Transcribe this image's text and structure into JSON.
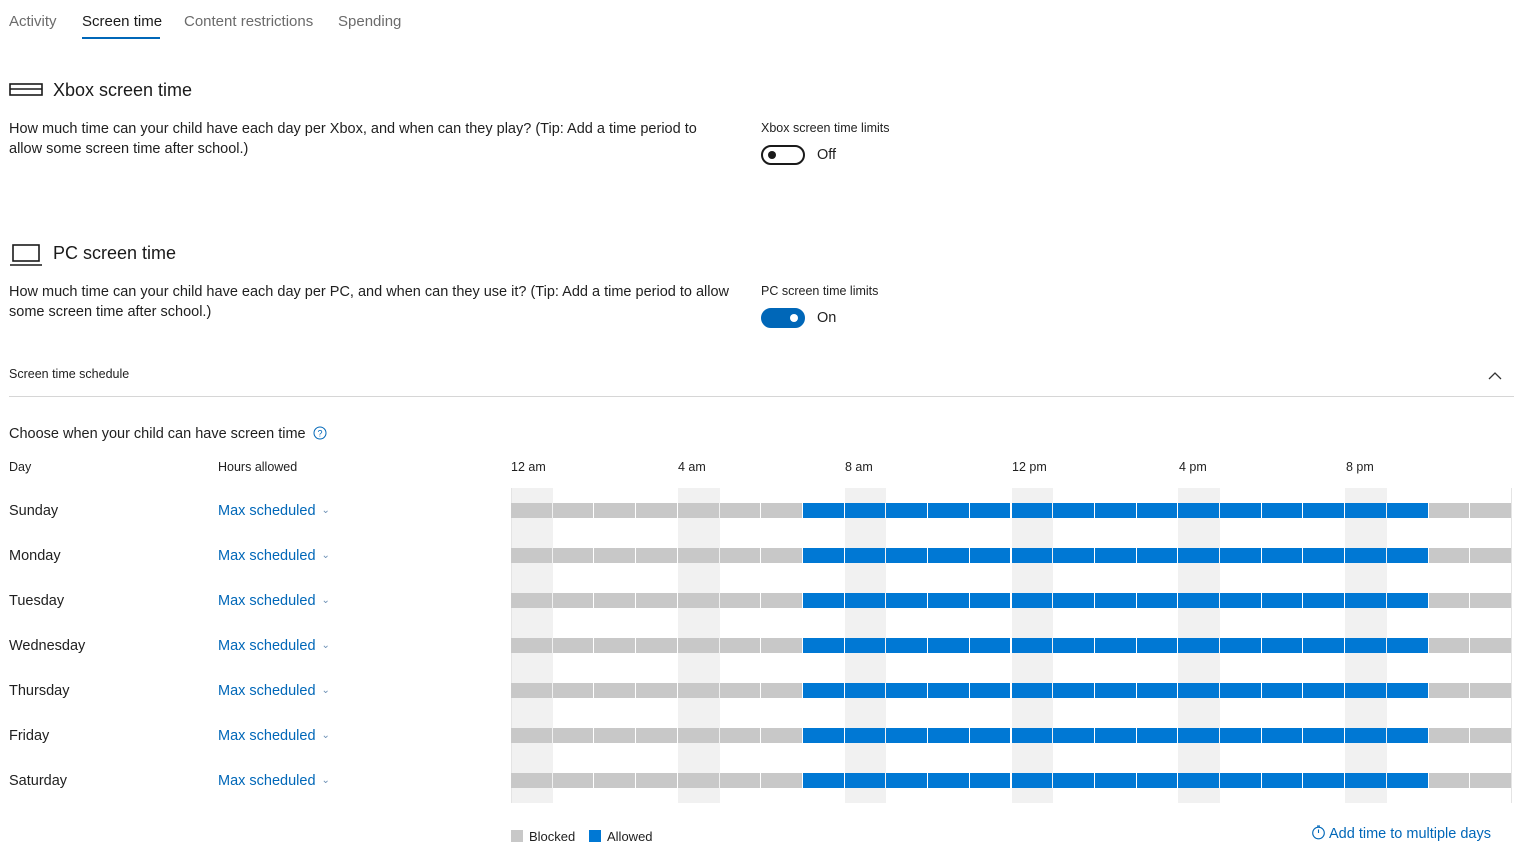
{
  "tabs": [
    {
      "label": "Activity",
      "active": false
    },
    {
      "label": "Screen time",
      "active": true
    },
    {
      "label": "Content restrictions",
      "active": false
    },
    {
      "label": "Spending",
      "active": false
    }
  ],
  "xbox": {
    "title": "Xbox screen time",
    "description": "How much time can your child have each day per Xbox, and when can they play? (Tip: Add a time period to allow some screen time after school.)",
    "limits_label": "Xbox screen time limits",
    "toggle_state": "Off"
  },
  "pc": {
    "title": "PC screen time",
    "description": "How much time can your child have each day per PC, and when can they use it? (Tip: Add a time period to allow some screen time after school.)",
    "limits_label": "PC screen time limits",
    "toggle_state": "On"
  },
  "schedule": {
    "header": "Screen time schedule",
    "prompt": "Choose when your child can have screen time",
    "col_day": "Day",
    "col_hours": "Hours allowed",
    "time_labels": [
      "12 am",
      "4 am",
      "8 am",
      "12 pm",
      "4 pm",
      "8 pm"
    ],
    "days": [
      {
        "name": "Sunday",
        "hours": "Max scheduled",
        "allowed_from_hour": 7,
        "allowed_to_hour": 22
      },
      {
        "name": "Monday",
        "hours": "Max scheduled",
        "allowed_from_hour": 7,
        "allowed_to_hour": 22
      },
      {
        "name": "Tuesday",
        "hours": "Max scheduled",
        "allowed_from_hour": 7,
        "allowed_to_hour": 22
      },
      {
        "name": "Wednesday",
        "hours": "Max scheduled",
        "allowed_from_hour": 7,
        "allowed_to_hour": 22
      },
      {
        "name": "Thursday",
        "hours": "Max scheduled",
        "allowed_from_hour": 7,
        "allowed_to_hour": 22
      },
      {
        "name": "Friday",
        "hours": "Max scheduled",
        "allowed_from_hour": 7,
        "allowed_to_hour": 22
      },
      {
        "name": "Saturday",
        "hours": "Max scheduled",
        "allowed_from_hour": 7,
        "allowed_to_hour": 22
      }
    ],
    "legend_blocked": "Blocked",
    "legend_allowed": "Allowed",
    "add_link": "Add time to multiple days"
  },
  "colors": {
    "accent": "#0067b8",
    "blocked": "#c8c8c8",
    "allowed": "#0078d4"
  }
}
